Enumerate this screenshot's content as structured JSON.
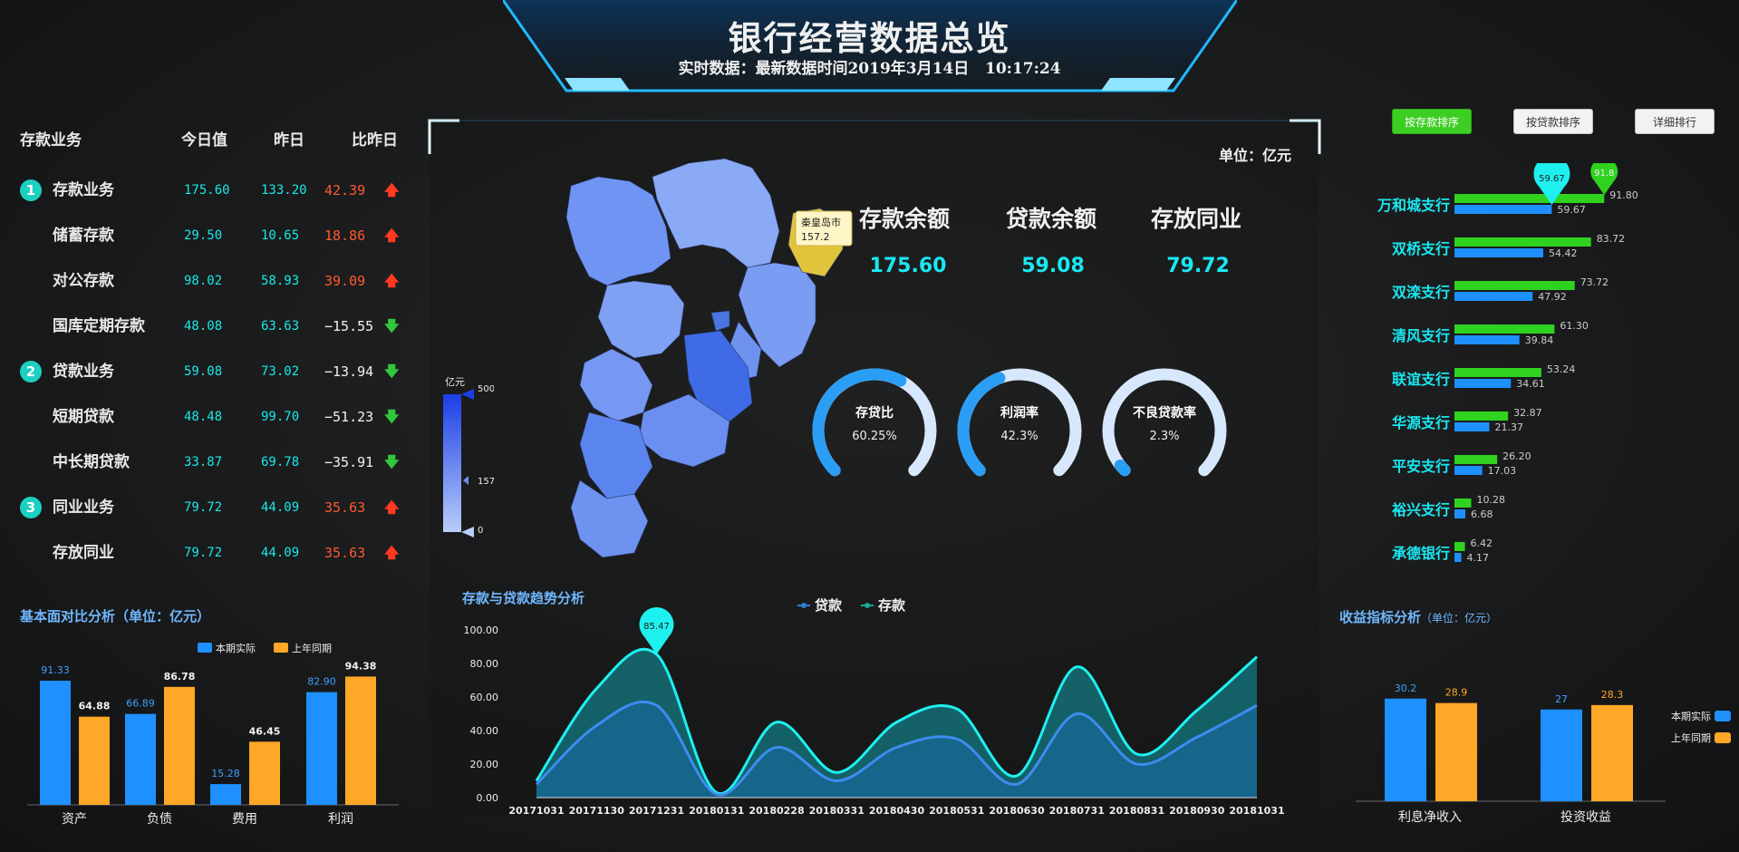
{
  "header": {
    "title": "银行经营数据总览",
    "subtitle": "实时数据：最新数据时间2019年3月14日   10:17:24"
  },
  "deposit_table": {
    "columns": [
      "存款业务",
      "今日值",
      "昨日",
      "比昨日"
    ],
    "rows": [
      {
        "badge": "1",
        "name": "存款业务",
        "today": "175.60",
        "yesterday": "133.20",
        "change": "42.39",
        "dir": "up"
      },
      {
        "badge": "",
        "name": "储蓄存款",
        "today": "29.50",
        "yesterday": "10.65",
        "change": "18.86",
        "dir": "up"
      },
      {
        "badge": "",
        "name": "对公存款",
        "today": "98.02",
        "yesterday": "58.93",
        "change": "39.09",
        "dir": "up"
      },
      {
        "badge": "",
        "name": "国库定期存款",
        "today": "48.08",
        "yesterday": "63.63",
        "change": "−15.55",
        "dir": "down"
      },
      {
        "badge": "2",
        "name": "贷款业务",
        "today": "59.08",
        "yesterday": "73.02",
        "change": "−13.94",
        "dir": "down"
      },
      {
        "badge": "",
        "name": "短期贷款",
        "today": "48.48",
        "yesterday": "99.70",
        "change": "−51.23",
        "dir": "down"
      },
      {
        "badge": "",
        "name": "中长期贷款",
        "today": "33.87",
        "yesterday": "69.78",
        "change": "−35.91",
        "dir": "down"
      },
      {
        "badge": "3",
        "name": "同业业务",
        "today": "79.72",
        "yesterday": "44.09",
        "change": "35.63",
        "dir": "up"
      },
      {
        "badge": "",
        "name": "存放同业",
        "today": "79.72",
        "yesterday": "44.09",
        "change": "35.63",
        "dir": "up"
      }
    ]
  },
  "center": {
    "unit": "单位：亿元",
    "kpis": [
      {
        "label": "存款余额",
        "value": "175.60"
      },
      {
        "label": "贷款余额",
        "value": "59.08"
      },
      {
        "label": "存放同业",
        "value": "79.72"
      }
    ],
    "gauges": [
      {
        "label": "存贷比",
        "value": "60.25%",
        "fraction": 0.6025
      },
      {
        "label": "利润率",
        "value": "42.3%",
        "fraction": 0.423
      },
      {
        "label": "不良贷款率",
        "value": "2.3%",
        "fraction": 0.023
      }
    ],
    "map": {
      "tooltip_name": "秦皇岛市",
      "tooltip_value": "157.2",
      "legend_unit": "亿元",
      "legend_max": "500",
      "legend_mid": "157",
      "legend_min": "0"
    }
  },
  "ranking": {
    "buttons": [
      {
        "label": "按存款排序",
        "active": true
      },
      {
        "label": "按贷款排序",
        "active": false
      },
      {
        "label": "详细排行",
        "active": false
      }
    ]
  },
  "colors": {
    "cyan": "#19e8f0",
    "blue_bar": "#1e90ff",
    "orange_bar": "#ffa726",
    "green_bar": "#2fd21f",
    "up": "#ff5a30",
    "down_arrow": "#30c83a"
  },
  "chart_data": [
    {
      "type": "bar",
      "id": "branch-ranking",
      "orientation": "horizontal",
      "categories": [
        "万和城支行",
        "双桥支行",
        "双滦支行",
        "清风支行",
        "联谊支行",
        "华源支行",
        "平安支行",
        "裕兴支行",
        "承德银行"
      ],
      "series": [
        {
          "values": [
            91.8,
            83.72,
            73.72,
            61.3,
            53.24,
            32.87,
            26.2,
            10.28,
            6.42
          ]
        },
        {
          "values": [
            59.67,
            54.42,
            47.92,
            39.84,
            34.61,
            21.37,
            17.03,
            6.68,
            4.17
          ]
        }
      ],
      "markers": [
        {
          "series_index": 0,
          "category": "万和城支行",
          "label": "91.8"
        },
        {
          "series_index": 1,
          "category": "万和城支行",
          "label": "59.67"
        }
      ]
    },
    {
      "type": "bar",
      "id": "basic-comparison",
      "title": "基本面对比分析（单位：亿元）",
      "categories": [
        "资产",
        "负债",
        "费用",
        "利润"
      ],
      "series": [
        {
          "name": "本期实际",
          "values": [
            91.33,
            66.89,
            15.28,
            82.9
          ]
        },
        {
          "name": "上年同期",
          "values": [
            64.88,
            86.78,
            46.45,
            94.38
          ]
        }
      ],
      "legend": "top-right",
      "ylim": [
        0,
        100
      ]
    },
    {
      "type": "area",
      "id": "trend",
      "title": "存款与贷款趋势分析",
      "x": [
        "20171031",
        "20171130",
        "20171231",
        "20180131",
        "20180228",
        "20180331",
        "20180430",
        "20180531",
        "20180630",
        "20180731",
        "20180831",
        "20180930",
        "20181031"
      ],
      "y_ticks": [
        "0.00",
        "20.00",
        "40.00",
        "60.00",
        "80.00",
        "100.00"
      ],
      "ylim": [
        0,
        100
      ],
      "series": [
        {
          "name": "贷款",
          "values": [
            8,
            43,
            55,
            2,
            30,
            10,
            30,
            35,
            8,
            50,
            20,
            36,
            55
          ]
        },
        {
          "name": "存款",
          "values": [
            10,
            65,
            85.47,
            3,
            45,
            15,
            45,
            53,
            13,
            78,
            26,
            52,
            84
          ]
        }
      ],
      "markers": [
        {
          "series": "存款",
          "x": "20171231",
          "label": "85.47"
        }
      ],
      "legend": "top-center"
    },
    {
      "type": "bar",
      "id": "income-analysis",
      "title": "收益指标分析",
      "subtitle": "（单位：亿元）",
      "categories": [
        "利息净收入",
        "投资收益"
      ],
      "series": [
        {
          "name": "本期实际",
          "values": [
            30.2,
            27
          ]
        },
        {
          "name": "上年同期",
          "values": [
            28.9,
            28.3
          ]
        }
      ],
      "legend": "right",
      "ylim": [
        0,
        40
      ]
    }
  ]
}
